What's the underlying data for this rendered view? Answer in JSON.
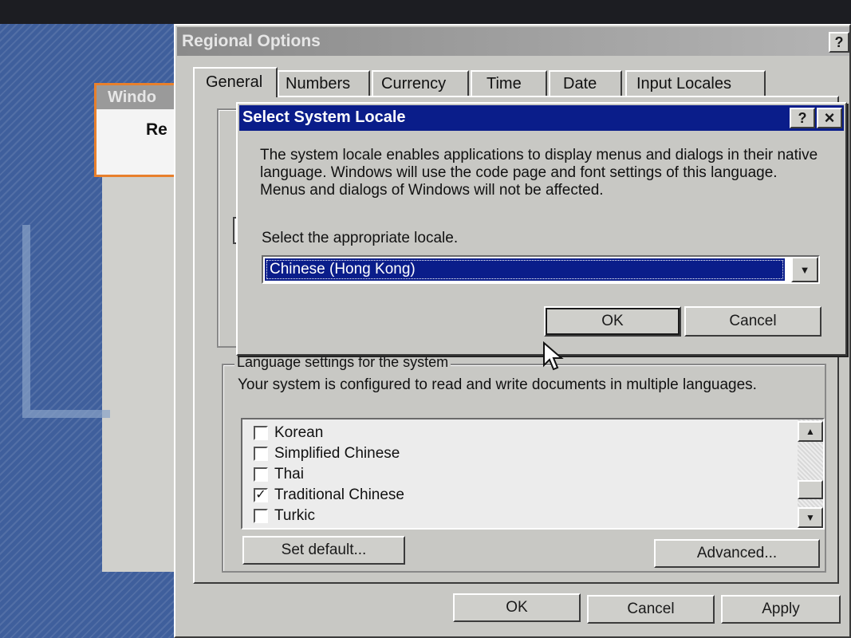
{
  "back_window": {
    "title": "Windo",
    "content_text": "Re"
  },
  "regional": {
    "title": "Regional Options",
    "help_btn": "?",
    "tabs": [
      {
        "label": "General",
        "active": true
      },
      {
        "label": "Numbers",
        "active": false
      },
      {
        "label": "Currency",
        "active": false
      },
      {
        "label": "Time",
        "active": false
      },
      {
        "label": "Date",
        "active": false
      },
      {
        "label": "Input Locales",
        "active": false
      }
    ],
    "lang_group_label": "Language settings for the system",
    "lang_description": "Your system is configured to read and write documents in multiple languages.",
    "languages": [
      {
        "label": "Korean",
        "checked": false
      },
      {
        "label": "Simplified Chinese",
        "checked": false
      },
      {
        "label": "Thai",
        "checked": false
      },
      {
        "label": "Traditional Chinese",
        "checked": true
      },
      {
        "label": "Turkic",
        "checked": false
      }
    ],
    "set_default_label": "Set default...",
    "advanced_label": "Advanced...",
    "ok_label": "OK",
    "cancel_label": "Cancel",
    "apply_label": "Apply"
  },
  "locale_dialog": {
    "title": "Select System Locale",
    "help_btn": "?",
    "close_btn": "×",
    "description": "The system locale enables applications to display menus and dialogs in their native language.  Windows will use the code page and font settings of this language.  Menus and dialogs of Windows will not be affected.",
    "select_label": "Select the appropriate locale.",
    "selected_locale": "Chinese (Hong Kong)",
    "ok_label": "OK",
    "cancel_label": "Cancel"
  },
  "colors": {
    "titlebar_active": "#0a1d8a",
    "titlebar_inactive": "#8a8a8a",
    "selection": "#0a1d8a"
  }
}
